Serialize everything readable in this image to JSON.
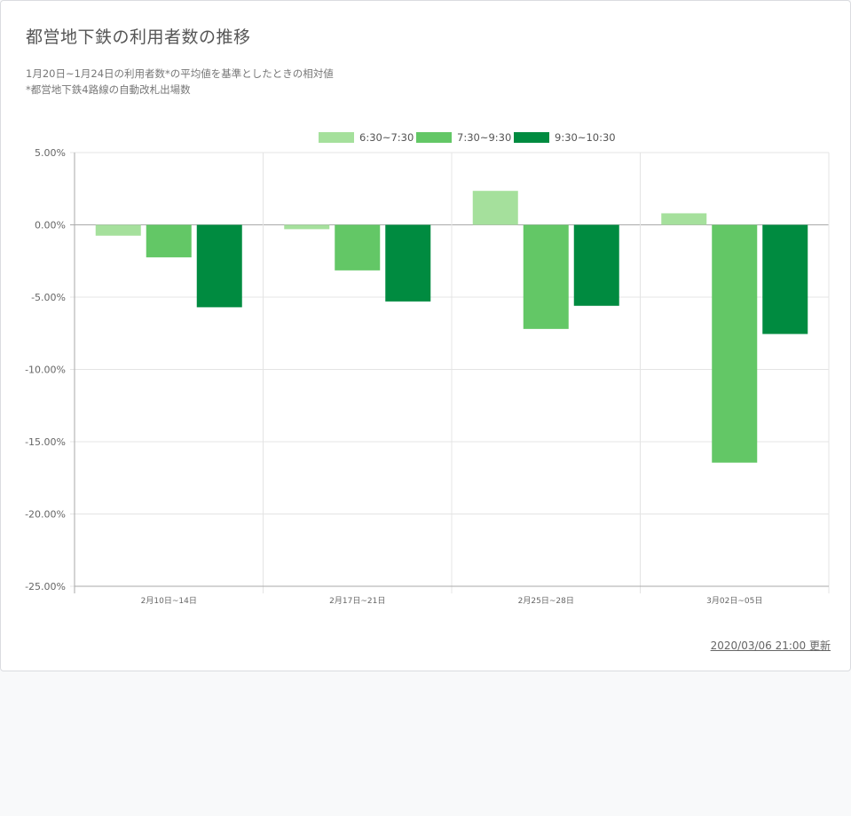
{
  "card": {
    "title": "都営地下鉄の利用者数の推移",
    "note_line1": "1月20日~1月24日の利用者数*の平均値を基準としたときの相対値",
    "note_line2": "*都営地下鉄4路線の自動改札出場数",
    "updated": "2020/03/06 21:00 更新"
  },
  "chart_data": {
    "type": "bar",
    "categories": [
      "2月10日~14日",
      "2月17日~21日",
      "2月25日~28日",
      "3月02日~05日"
    ],
    "series": [
      {
        "name": "6:30~7:30",
        "color": "#a5e09c",
        "values": [
          -0.75,
          -0.3,
          2.35,
          0.8
        ]
      },
      {
        "name": "7:30~9:30",
        "color": "#63c766",
        "values": [
          -2.25,
          -3.15,
          -7.2,
          -16.45
        ]
      },
      {
        "name": "9:30~10:30",
        "color": "#008b40",
        "values": [
          -5.7,
          -5.3,
          -5.6,
          -7.55
        ]
      }
    ],
    "yticks": [
      "5.00%",
      "0.00%",
      "-5.00%",
      "-10.00%",
      "-15.00%",
      "-20.00%",
      "-25.00%"
    ],
    "ylim": [
      -25,
      5
    ],
    "ytick_step": 5,
    "grid": true,
    "legend_position": "top-center"
  }
}
